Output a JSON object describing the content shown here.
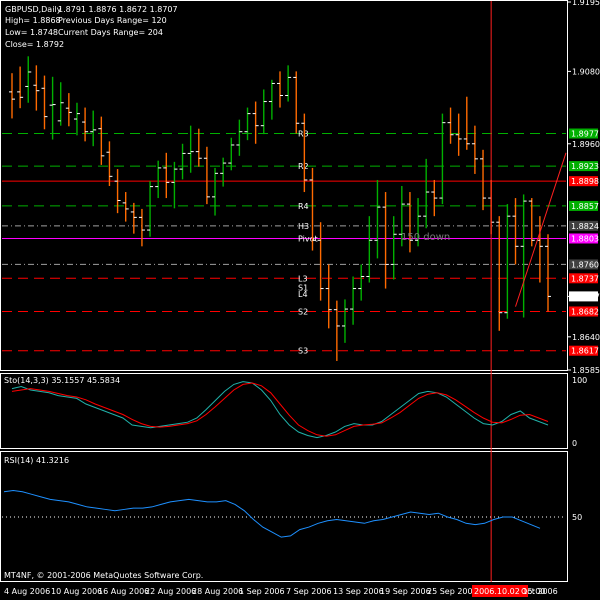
{
  "header": {
    "symbol": "GBPUSD,Daily",
    "ohlc": "1.8791 1.8876 1.8672 1.8707",
    "high": "High= 1.8868",
    "prev_range": "Previous Days Range= 120",
    "low": "Low= 1.8748",
    "curr_range": "Current Days Range= 204",
    "close": "Close= 1.8792"
  },
  "annotation": "150 down",
  "copyright": "MT4NF, © 2001-2006 MetaQuotes Software Corp.",
  "colors": {
    "bull": "#00b000",
    "bear": "#ff6a00",
    "stoch_main": "#20b2aa",
    "stoch_signal": "#ff0000",
    "rsi": "#1e90ff",
    "pivot": "#ff00ff",
    "resistance_red": "#ff0000",
    "green_level": "#00b000",
    "grid": "#ffffff",
    "vline": "#ff2020"
  },
  "chart_data": [
    {
      "type": "candlestick",
      "panel": "price",
      "ylim": [
        1.8585,
        1.9195
      ],
      "y_ticks": [
        "1.9195",
        "1.9080",
        "1.8960",
        "1.8707",
        "1.8640",
        "1.8585"
      ],
      "right_labels": [
        {
          "text": "1.8977",
          "value": 1.8977,
          "bg": "#00b000"
        },
        {
          "text": "1.8923",
          "value": 1.8923,
          "bg": "#00b000"
        },
        {
          "text": "1.8898",
          "value": 1.8898,
          "bg": "#ff0000"
        },
        {
          "text": "1.8857",
          "value": 1.8857,
          "bg": "#00b000"
        },
        {
          "text": "1.8824",
          "value": 1.8824,
          "bg": "#404040"
        },
        {
          "text": "1.8803",
          "value": 1.8803,
          "bg": "#ff00ff"
        },
        {
          "text": "1.8760",
          "value": 1.876,
          "bg": "#404040"
        },
        {
          "text": "1.8737",
          "value": 1.8737,
          "bg": "#ff0000"
        },
        {
          "text": "1.8707",
          "value": 1.8707,
          "bg": "#ffffff"
        },
        {
          "text": "1.8682",
          "value": 1.8682,
          "bg": "#ff0000"
        },
        {
          "text": "1.8617",
          "value": 1.8617,
          "bg": "#ff0000"
        }
      ],
      "levels": [
        {
          "name": "R3",
          "value": 1.8977,
          "style": "green-dash"
        },
        {
          "name": "R2",
          "value": 1.8923,
          "style": "green-dash"
        },
        {
          "name": "",
          "value": 1.8898,
          "style": "red-solid"
        },
        {
          "name": "R4",
          "value": 1.8857,
          "style": "green-dash"
        },
        {
          "name": "H3",
          "value": 1.8824,
          "style": "gray-dashdot"
        },
        {
          "name": "Pivot",
          "value": 1.8803,
          "style": "magenta"
        },
        {
          "name": "",
          "value": 1.876,
          "style": "gray-dashdot"
        },
        {
          "name": "L3",
          "value": 1.8737,
          "style": "red-dash"
        },
        {
          "name": "S1",
          "value": 1.8722,
          "style": "none"
        },
        {
          "name": "L4",
          "value": 1.8711,
          "style": "none"
        },
        {
          "name": "S2",
          "value": 1.8682,
          "style": "red-dash"
        },
        {
          "name": "S3",
          "value": 1.8617,
          "style": "red-dash"
        }
      ],
      "x_labels": [
        "4 Aug 2006",
        "10 Aug 2006",
        "16 Aug 2006",
        "22 Aug 2006",
        "28 Aug 2006",
        "1 Sep 2006",
        "7 Sep 2006",
        "13 Sep 2006",
        "19 Sep 2006",
        "25 Sep 2006",
        "2006.10.02 15:00",
        "Oct 2006"
      ],
      "bars": [
        {
          "o": 1.9046,
          "h": 1.9077,
          "l": 1.9002,
          "c": 1.9034
        },
        {
          "o": 1.9046,
          "h": 1.9088,
          "l": 1.9019,
          "c": 1.9037
        },
        {
          "o": 1.9055,
          "h": 1.9105,
          "l": 1.9028,
          "c": 1.9079
        },
        {
          "o": 1.9057,
          "h": 1.909,
          "l": 1.9015,
          "c": 1.9048
        },
        {
          "o": 1.9052,
          "h": 1.9073,
          "l": 1.8984,
          "c": 1.9005
        },
        {
          "o": 1.9024,
          "h": 1.9071,
          "l": 1.8967,
          "c": 1.9025
        },
        {
          "o": 1.8998,
          "h": 1.9062,
          "l": 1.899,
          "c": 1.9028
        },
        {
          "o": 1.9019,
          "h": 1.9044,
          "l": 1.8989,
          "c": 1.9012
        },
        {
          "o": 1.9001,
          "h": 1.9028,
          "l": 1.8974,
          "c": 1.901
        },
        {
          "o": 1.8996,
          "h": 1.902,
          "l": 1.8964,
          "c": 1.898
        },
        {
          "o": 1.898,
          "h": 1.9015,
          "l": 1.8956,
          "c": 1.8983
        },
        {
          "o": 1.8985,
          "h": 1.9005,
          "l": 1.8925,
          "c": 1.894
        },
        {
          "o": 1.8946,
          "h": 1.8964,
          "l": 1.889,
          "c": 1.8906
        },
        {
          "o": 1.8898,
          "h": 1.8918,
          "l": 1.8845,
          "c": 1.8866
        },
        {
          "o": 1.8862,
          "h": 1.888,
          "l": 1.8831,
          "c": 1.8852
        },
        {
          "o": 1.8847,
          "h": 1.8862,
          "l": 1.8811,
          "c": 1.8838
        },
        {
          "o": 1.8838,
          "h": 1.8852,
          "l": 1.879,
          "c": 1.8817
        },
        {
          "o": 1.8817,
          "h": 1.8898,
          "l": 1.8806,
          "c": 1.8889
        },
        {
          "o": 1.8889,
          "h": 1.8932,
          "l": 1.887,
          "c": 1.892
        },
        {
          "o": 1.892,
          "h": 1.8945,
          "l": 1.887,
          "c": 1.8896
        },
        {
          "o": 1.8896,
          "h": 1.893,
          "l": 1.8853,
          "c": 1.8918
        },
        {
          "o": 1.8918,
          "h": 1.896,
          "l": 1.8901,
          "c": 1.8944
        },
        {
          "o": 1.8944,
          "h": 1.899,
          "l": 1.8912,
          "c": 1.8947
        },
        {
          "o": 1.8947,
          "h": 1.8985,
          "l": 1.8922,
          "c": 1.8936
        },
        {
          "o": 1.8936,
          "h": 1.8955,
          "l": 1.886,
          "c": 1.8872
        },
        {
          "o": 1.8872,
          "h": 1.892,
          "l": 1.8841,
          "c": 1.8911
        },
        {
          "o": 1.8911,
          "h": 1.8937,
          "l": 1.8889,
          "c": 1.8928
        },
        {
          "o": 1.8928,
          "h": 1.897,
          "l": 1.8916,
          "c": 1.8958
        },
        {
          "o": 1.8958,
          "h": 1.9,
          "l": 1.894,
          "c": 1.898
        },
        {
          "o": 1.898,
          "h": 1.902,
          "l": 1.8966,
          "c": 1.901
        },
        {
          "o": 1.901,
          "h": 1.903,
          "l": 1.896,
          "c": 1.899
        },
        {
          "o": 1.899,
          "h": 1.905,
          "l": 1.8976,
          "c": 1.903
        },
        {
          "o": 1.903,
          "h": 1.9066,
          "l": 1.9,
          "c": 1.906
        },
        {
          "o": 1.906,
          "h": 1.908,
          "l": 1.902,
          "c": 1.904
        },
        {
          "o": 1.904,
          "h": 1.909,
          "l": 1.903,
          "c": 1.907
        },
        {
          "o": 1.907,
          "h": 1.908,
          "l": 1.8977,
          "c": 1.8994
        },
        {
          "o": 1.8994,
          "h": 1.901,
          "l": 1.888,
          "c": 1.89
        },
        {
          "o": 1.89,
          "h": 1.892,
          "l": 1.8783,
          "c": 1.88
        },
        {
          "o": 1.88,
          "h": 1.883,
          "l": 1.87,
          "c": 1.872
        },
        {
          "o": 1.872,
          "h": 1.876,
          "l": 1.8654,
          "c": 1.8685
        },
        {
          "o": 1.8685,
          "h": 1.87,
          "l": 1.86,
          "c": 1.8658
        },
        {
          "o": 1.8658,
          "h": 1.8702,
          "l": 1.863,
          "c": 1.8686
        },
        {
          "o": 1.8686,
          "h": 1.874,
          "l": 1.866,
          "c": 1.872
        },
        {
          "o": 1.872,
          "h": 1.876,
          "l": 1.87,
          "c": 1.874
        },
        {
          "o": 1.874,
          "h": 1.884,
          "l": 1.873,
          "c": 1.88
        },
        {
          "o": 1.88,
          "h": 1.89,
          "l": 1.877,
          "c": 1.8855
        },
        {
          "o": 1.8855,
          "h": 1.888,
          "l": 1.872,
          "c": 1.876
        },
        {
          "o": 1.876,
          "h": 1.884,
          "l": 1.8735,
          "c": 1.881
        },
        {
          "o": 1.881,
          "h": 1.889,
          "l": 1.879,
          "c": 1.886
        },
        {
          "o": 1.886,
          "h": 1.888,
          "l": 1.878,
          "c": 1.88
        },
        {
          "o": 1.88,
          "h": 1.887,
          "l": 1.879,
          "c": 1.884
        },
        {
          "o": 1.884,
          "h": 1.8935,
          "l": 1.882,
          "c": 1.888
        },
        {
          "o": 1.888,
          "h": 1.89,
          "l": 1.884,
          "c": 1.887
        },
        {
          "o": 1.887,
          "h": 1.901,
          "l": 1.886,
          "c": 1.8995
        },
        {
          "o": 1.8995,
          "h": 1.902,
          "l": 1.896,
          "c": 1.8975
        },
        {
          "o": 1.8975,
          "h": 1.901,
          "l": 1.894,
          "c": 1.8968
        },
        {
          "o": 1.8968,
          "h": 1.9038,
          "l": 1.895,
          "c": 1.896
        },
        {
          "o": 1.896,
          "h": 1.899,
          "l": 1.891,
          "c": 1.8935
        },
        {
          "o": 1.8935,
          "h": 1.895,
          "l": 1.885,
          "c": 1.887
        },
        {
          "o": 1.887,
          "h": 1.89,
          "l": 1.881,
          "c": 1.883
        },
        {
          "o": 1.883,
          "h": 1.884,
          "l": 1.865,
          "c": 1.868
        },
        {
          "o": 1.868,
          "h": 1.886,
          "l": 1.867,
          "c": 1.884
        },
        {
          "o": 1.884,
          "h": 1.887,
          "l": 1.876,
          "c": 1.879
        },
        {
          "o": 1.879,
          "h": 1.8876,
          "l": 1.8672,
          "c": 1.8865
        },
        {
          "o": 1.8865,
          "h": 1.887,
          "l": 1.879,
          "c": 1.88
        },
        {
          "o": 1.88,
          "h": 1.884,
          "l": 1.873,
          "c": 1.879
        },
        {
          "o": 1.879,
          "h": 1.881,
          "l": 1.8682,
          "c": 1.8707
        }
      ],
      "trendline": {
        "start_bar": 62,
        "start": 1.869,
        "end": 1.8945
      }
    },
    {
      "type": "line",
      "panel": "stoch",
      "label": "Sto(14,3,3) 35.1557 45.5834",
      "ylim": [
        0,
        100
      ],
      "y_ticks": [
        "100",
        "0"
      ],
      "series": [
        {
          "key": "main",
          "values": [
            82,
            85,
            80,
            78,
            76,
            72,
            70,
            68,
            60,
            55,
            50,
            45,
            40,
            30,
            28,
            26,
            28,
            30,
            32,
            34,
            40,
            52,
            65,
            78,
            88,
            92,
            90,
            80,
            65,
            45,
            30,
            20,
            15,
            12,
            15,
            20,
            28,
            32,
            30,
            30,
            35,
            45,
            55,
            65,
            75,
            78,
            76,
            70,
            60,
            50,
            40,
            32,
            30,
            35,
            45,
            50,
            40,
            35,
            30
          ]
        },
        {
          "key": "signal",
          "values": [
            78,
            80,
            82,
            80,
            78,
            75,
            72,
            70,
            66,
            60,
            55,
            50,
            45,
            38,
            32,
            28,
            27,
            28,
            30,
            32,
            36,
            45,
            56,
            68,
            80,
            88,
            90,
            86,
            76,
            60,
            44,
            30,
            22,
            16,
            14,
            16,
            22,
            28,
            30,
            31,
            33,
            40,
            48,
            58,
            68,
            74,
            76,
            73,
            66,
            57,
            48,
            40,
            34,
            33,
            38,
            44,
            45,
            40,
            35
          ]
        }
      ]
    },
    {
      "type": "line",
      "panel": "rsi",
      "label": "RSI(14) 41.3216",
      "ylim": [
        0,
        100
      ],
      "y_ticks": [
        "50"
      ],
      "series": [
        {
          "key": "rsi",
          "values": [
            70,
            71,
            70,
            68,
            66,
            64,
            63,
            62,
            60,
            58,
            57,
            56,
            55,
            56,
            57,
            57,
            58,
            60,
            62,
            63,
            64,
            63,
            62,
            62,
            63,
            60,
            55,
            48,
            42,
            38,
            34,
            35,
            40,
            42,
            45,
            47,
            48,
            47,
            46,
            45,
            47,
            48,
            50,
            52,
            54,
            53,
            52,
            53,
            50,
            48,
            45,
            44,
            45,
            48,
            50,
            50,
            47,
            44,
            41
          ]
        }
      ]
    }
  ]
}
